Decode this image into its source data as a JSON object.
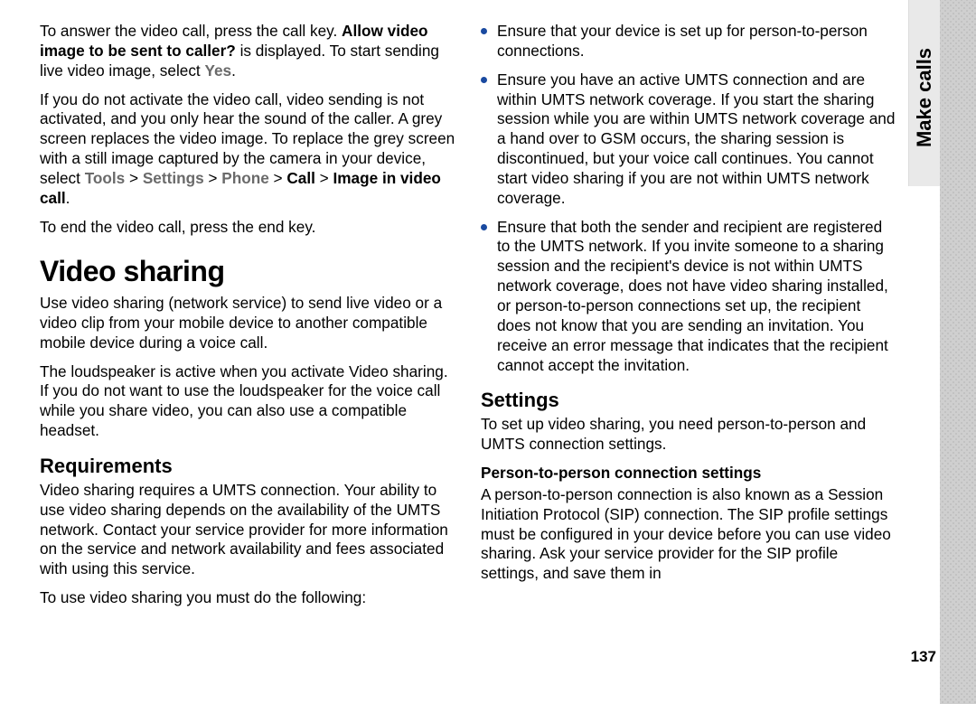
{
  "sideTab": "Make calls",
  "pageNumber": "137",
  "col1": {
    "p1_a": "To answer the video call, press the call key. ",
    "p1_bold": "Allow video image to be sent to caller?",
    "p1_b": " is displayed. To start sending live video image, select ",
    "p1_grey": "Yes",
    "p1_c": ".",
    "p2_a": "If you do not activate the video call, video sending is not activated, and you only hear the sound of the caller. A grey screen replaces the video image. To replace the grey screen with a still image captured by the camera in your device, select ",
    "p2_g1": "Tools",
    "p2_s1": " > ",
    "p2_g2": "Settings",
    "p2_s2": " > ",
    "p2_g3": "Phone",
    "p2_s3": " > ",
    "p2_bold1": "Call",
    "p2_s4": " > ",
    "p2_bold2": "Image in video call",
    "p2_end": ".",
    "p3": "To end the video call, press the end key.",
    "h1": "Video sharing",
    "p4": "Use video sharing (network service) to send live video or a video clip from your mobile device to another compatible mobile device during a voice call.",
    "p5": "The loudspeaker is active when you activate Video sharing. If you do not want to use the loudspeaker for the voice call while you share video, you can also use a compatible headset.",
    "h2": "Requirements",
    "p6": "Video sharing requires a UMTS connection. Your ability to use video sharing depends on the availability of the UMTS network. Contact your service provider for more information on the service and network availability and fees associated with using this service.",
    "p7": "To use video sharing you must do the following:"
  },
  "col2": {
    "bullets": [
      "Ensure that your device is set up for person-to-person connections.",
      "Ensure you have an active UMTS connection and are within UMTS network coverage. If you start the sharing session while you are within UMTS network coverage and a hand over to GSM occurs, the sharing session is discontinued, but your voice call continues. You cannot start video sharing if you are not within UMTS network coverage.",
      "Ensure that both the sender and recipient are registered to the UMTS network. If you invite someone to a sharing session and the recipient's device is not within UMTS network coverage, does not have video sharing installed, or person-to-person connections set up, the recipient does not know that you are sending an invitation. You receive an error message that indicates that the recipient cannot accept the invitation."
    ],
    "h2": "Settings",
    "p1": "To set up video sharing, you need person-to-person and UMTS connection settings.",
    "h3": "Person-to-person connection settings",
    "p2": "A person-to-person connection is also known as a Session Initiation Protocol (SIP) connection. The SIP profile settings must be configured in your device before you can use video sharing. Ask your service provider for the SIP profile settings, and save them in"
  }
}
